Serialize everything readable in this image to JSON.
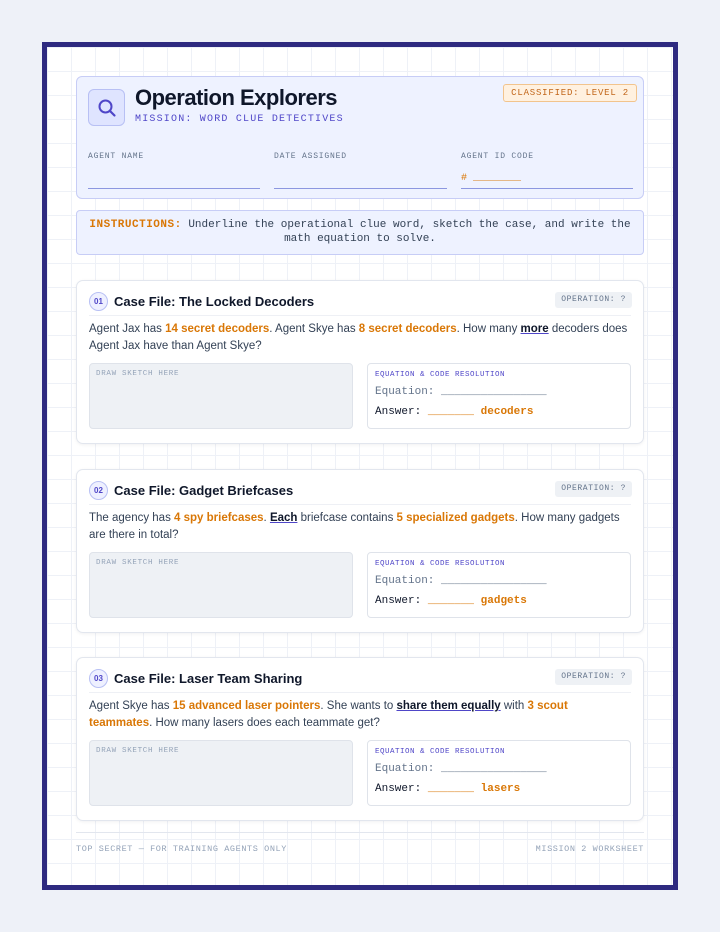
{
  "header": {
    "title": "Operation Explorers",
    "subtitle": "MISSION: WORD CLUE DETECTIVES",
    "badge": "CLASSIFIED: LEVEL 2",
    "logo_icon": "search-icon",
    "fields": [
      {
        "label": "AGENT NAME",
        "prefix": ""
      },
      {
        "label": "DATE ASSIGNED",
        "prefix": ""
      },
      {
        "label": "AGENT ID CODE",
        "prefix": "# ________"
      }
    ]
  },
  "instructions": {
    "lead": "INSTRUCTIONS:",
    "text": "Underline the operational clue word, sketch the case, and write the math equation to solve."
  },
  "cases": [
    {
      "number": "01",
      "title": "Case File: The Locked Decoders",
      "operation": "OPERATION: ?",
      "problem": {
        "t1": "Agent Jax has ",
        "h1": "14 secret decoders",
        "t2": ". Agent Skye has ",
        "h2": "8 secret decoders",
        "t3": ". How many ",
        "kw": "more",
        "t4": " decoders does Agent Jax have than Agent Skye?"
      },
      "sketch_label": "DRAW SKETCH HERE",
      "eq_heading": "EQUATION & CODE RESOLUTION",
      "equation_label": "Equation:",
      "equation_blank": "________________",
      "answer_label": "Answer:",
      "answer_blank": "_______",
      "answer_unit": "decoders"
    },
    {
      "number": "02",
      "title": "Case File: Gadget Briefcases",
      "operation": "OPERATION: ?",
      "problem": {
        "t1": "The agency has ",
        "h1": "4 spy briefcases",
        "t2": ". ",
        "kw": "Each",
        "t3": " briefcase contains ",
        "h2": "5 specialized gadgets",
        "t4": ". How many gadgets are there in total?"
      },
      "sketch_label": "DRAW SKETCH HERE",
      "eq_heading": "EQUATION & CODE RESOLUTION",
      "equation_label": "Equation:",
      "equation_blank": "________________",
      "answer_label": "Answer:",
      "answer_blank": "_______",
      "answer_unit": "gadgets"
    },
    {
      "number": "03",
      "title": "Case File: Laser Team Sharing",
      "operation": "OPERATION: ?",
      "problem": {
        "t1": "Agent Skye has ",
        "h1": "15 advanced laser pointers",
        "t2": ". She wants to ",
        "kw": "share them equally",
        "t3": " with ",
        "h2": "3 scout teammates",
        "t4": ". How many lasers does each teammate get?"
      },
      "sketch_label": "DRAW SKETCH HERE",
      "eq_heading": "EQUATION & CODE RESOLUTION",
      "equation_label": "Equation:",
      "equation_blank": "________________",
      "answer_label": "Answer:",
      "answer_blank": "_______",
      "answer_unit": "lasers"
    }
  ],
  "footer": {
    "left": "TOP SECRET — FOR TRAINING AGENTS ONLY",
    "right": "MISSION 2 WORKSHEET"
  },
  "colors": {
    "frame": "#2e2a80",
    "accent": "#4f46c8",
    "highlight": "#d97706"
  }
}
